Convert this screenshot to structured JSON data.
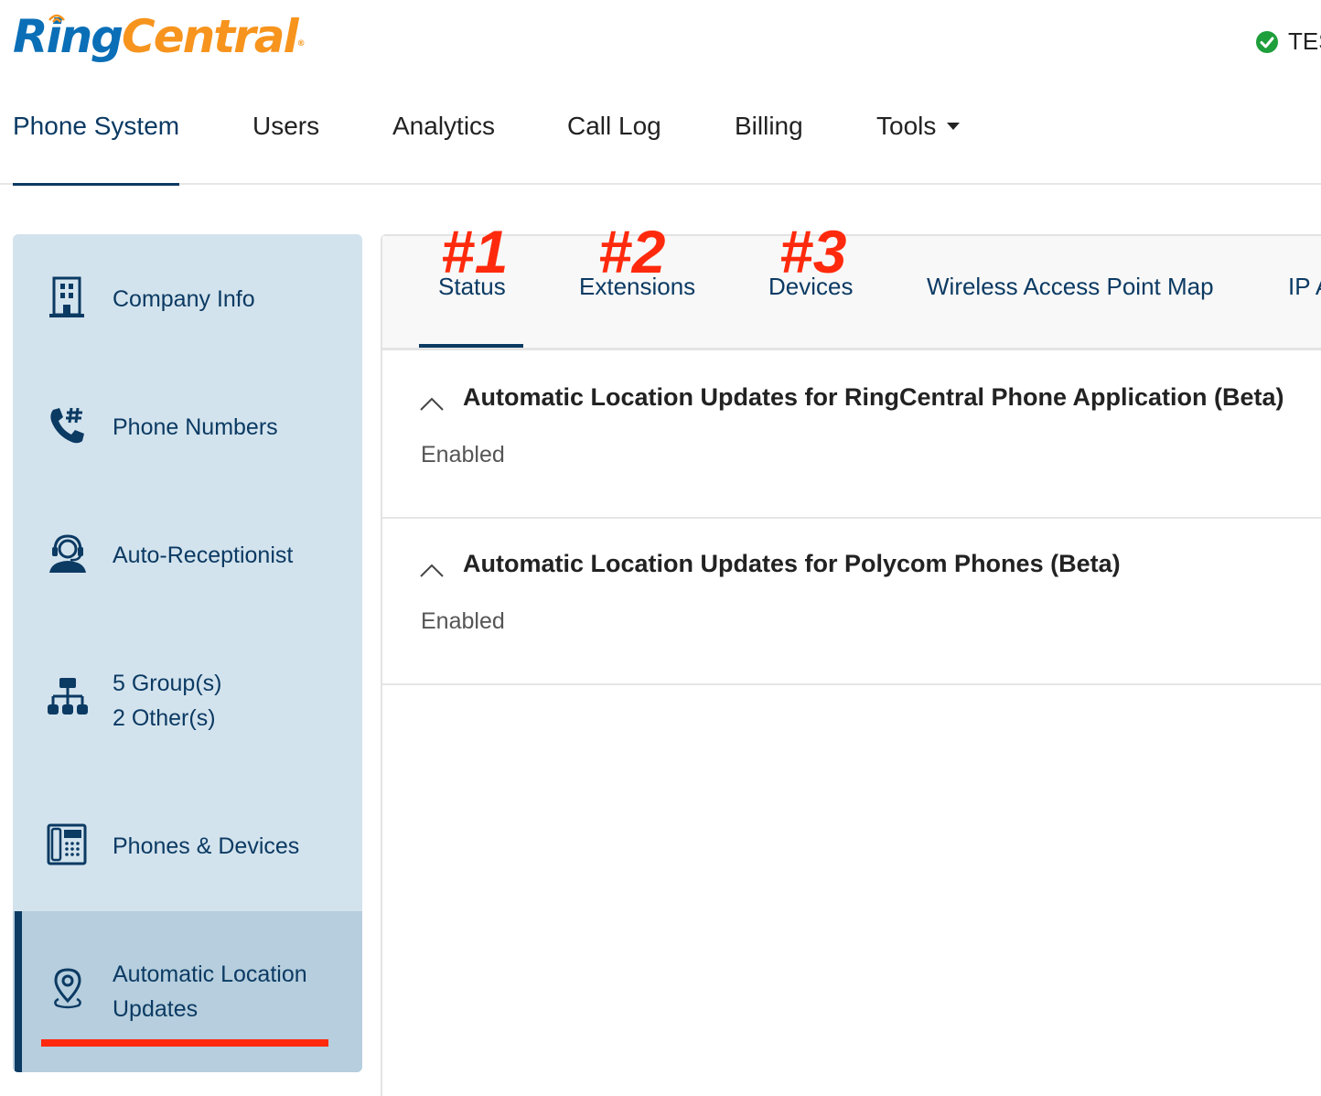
{
  "header": {
    "logo_ring": "Ring",
    "logo_central": "Central",
    "logo_reg": "®",
    "account_label": "TES"
  },
  "topnav": {
    "tabs": [
      {
        "label": "Phone System",
        "active": true
      },
      {
        "label": "Users"
      },
      {
        "label": "Analytics"
      },
      {
        "label": "Call Log"
      },
      {
        "label": "Billing"
      },
      {
        "label": "Tools"
      }
    ]
  },
  "sidebar": {
    "items": [
      {
        "label": "Company Info",
        "icon": "building-icon"
      },
      {
        "label": "Phone Numbers",
        "icon": "phone-hash-icon"
      },
      {
        "label": "Auto-Receptionist",
        "icon": "receptionist-headset-icon"
      },
      {
        "label_line1": "5 Group(s)",
        "label_line2": "2 Other(s)",
        "icon": "org-chart-icon"
      },
      {
        "label": "Phones & Devices",
        "icon": "desk-phone-icon"
      },
      {
        "label_line1": "Automatic Location",
        "label_line2": "Updates",
        "icon": "location-pin-icon",
        "active": true
      }
    ]
  },
  "panel": {
    "tabs": [
      {
        "label": "Status",
        "marker": "#1",
        "active": true
      },
      {
        "label": "Extensions",
        "marker": "#2"
      },
      {
        "label": "Devices",
        "marker": "#3"
      },
      {
        "label": "Wireless Access Point Map"
      },
      {
        "label": "IP A"
      }
    ],
    "sections": [
      {
        "title": "Automatic Location Updates for RingCentral Phone Application (Beta)",
        "value": "Enabled"
      },
      {
        "title": "Automatic Location Updates for Polycom Phones (Beta)",
        "value": "Enabled"
      }
    ]
  },
  "colors": {
    "brand_blue": "#0a6fb7",
    "brand_orange": "#f7941d",
    "navy": "#0b3a63",
    "annotation_red": "#ff2a0d",
    "sidebar_bg": "#d3e3ed",
    "sidebar_active_bg": "#b6cedd",
    "status_green": "#1f9e3c"
  }
}
